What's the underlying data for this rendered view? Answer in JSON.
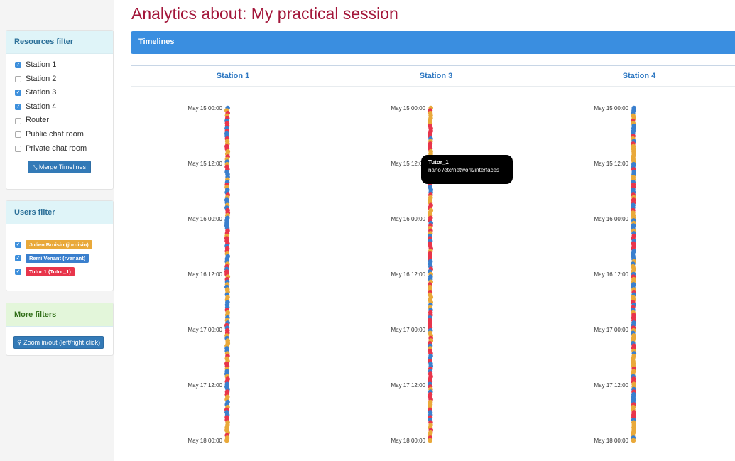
{
  "page": {
    "title": "Analytics about: My practical session"
  },
  "colors": {
    "title": "#a3163a",
    "accent": "#3a8ee0",
    "event_red": "#e8354b",
    "event_orange": "#e9a93a",
    "event_blue": "#3a7fcd"
  },
  "sidebar": {
    "resources": {
      "title": "Resources filter",
      "items": [
        {
          "label": "Station 1",
          "checked": true
        },
        {
          "label": "Station 2",
          "checked": false
        },
        {
          "label": "Station 3",
          "checked": true
        },
        {
          "label": "Station 4",
          "checked": true
        },
        {
          "label": "Router",
          "checked": false
        },
        {
          "label": "Public chat room",
          "checked": false
        },
        {
          "label": "Private chat room",
          "checked": false
        }
      ],
      "merge_button": "Merge Timelines",
      "merge_icon": "compress-arrows-icon"
    },
    "users": {
      "title": "Users filter",
      "items": [
        {
          "label": "Julien Broisin (jbroisin)",
          "checked": true,
          "color": "#e9a93a"
        },
        {
          "label": "Remi Venant (rvenant)",
          "checked": true,
          "color": "#3a7fcd"
        },
        {
          "label": "Tutor 1 (Tutor_1)",
          "checked": true,
          "color": "#e8354b"
        }
      ]
    },
    "more": {
      "title": "More filters",
      "zoom_button": "Zoom in/out (left/right click)",
      "zoom_icon": "search-icon"
    }
  },
  "timelines": {
    "title": "Timelines",
    "time_labels": [
      "May 15 00:00",
      "May 15 12:00",
      "May 16 00:00",
      "May 16 12:00",
      "May 17 00:00",
      "May 17 12:00",
      "May 18 00:00"
    ],
    "columns": [
      {
        "name": "Station 1"
      },
      {
        "name": "Station 3"
      },
      {
        "name": "Station 4"
      }
    ],
    "tooltip": {
      "user": "Tutor_1",
      "command": "nano /etc/network/interfaces"
    }
  }
}
